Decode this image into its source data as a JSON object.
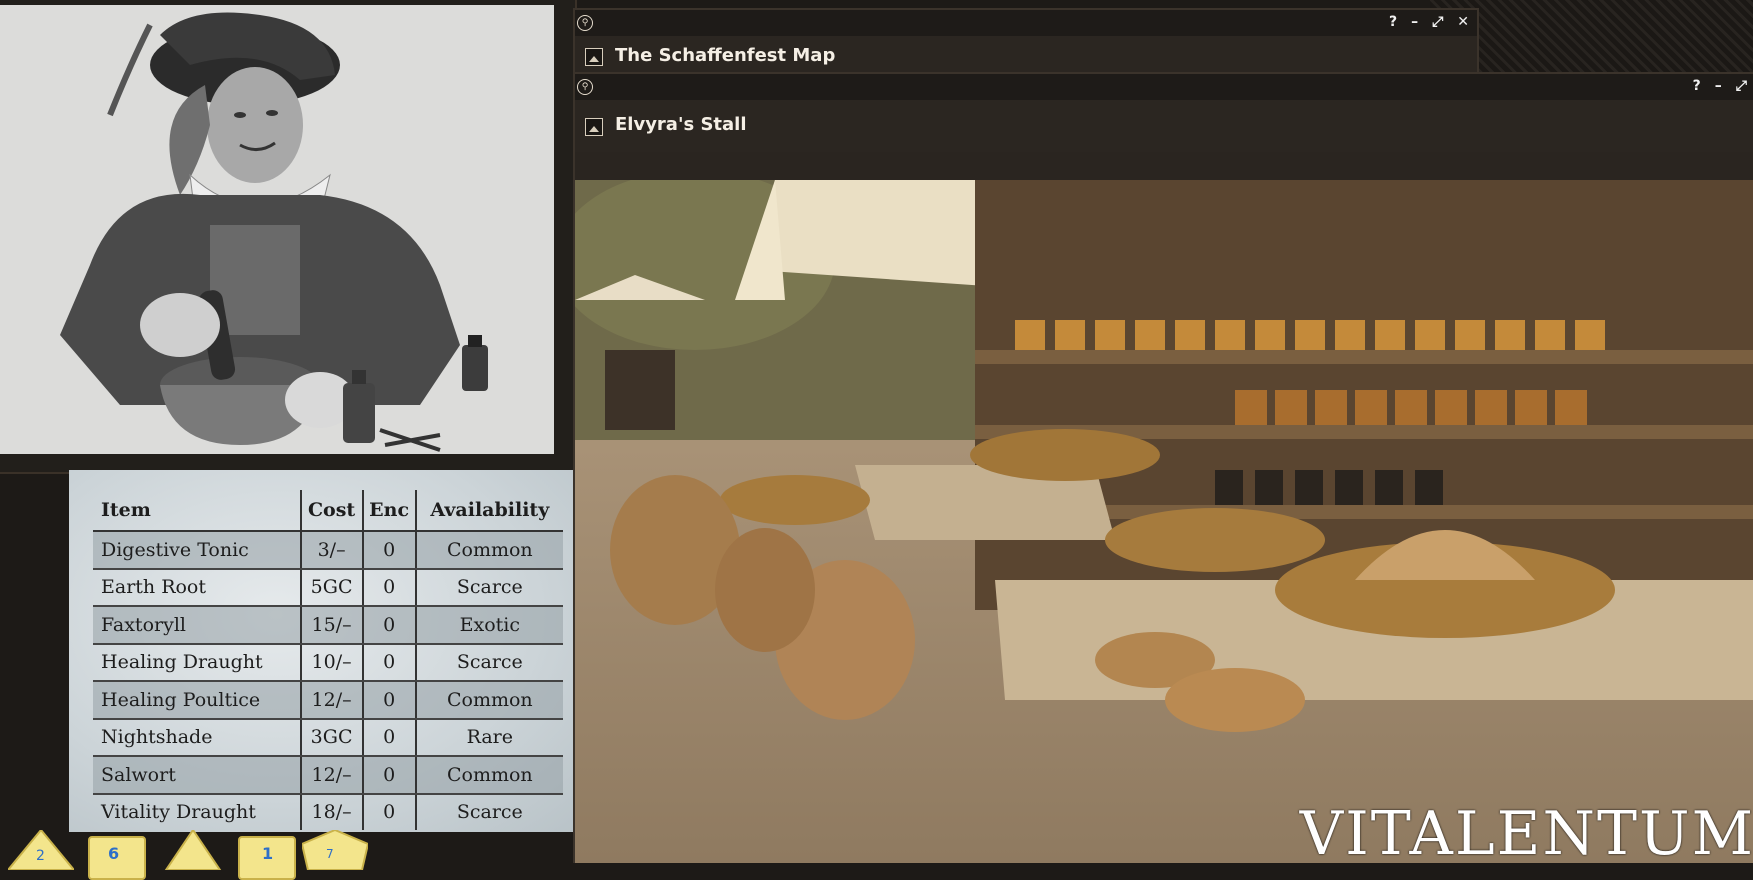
{
  "windows": [
    {
      "title": "The Schaffenfest Map",
      "controls": [
        "?",
        "–",
        "⤢",
        "✕"
      ]
    },
    {
      "title": "Elvyra's Stall",
      "controls": [
        "?",
        "–",
        "⤢"
      ]
    }
  ],
  "table": {
    "headers": [
      "Item",
      "Cost",
      "Enc",
      "Availability"
    ],
    "rows": [
      {
        "item": "Digestive Tonic",
        "cost": "3/–",
        "enc": "0",
        "availability": "Common"
      },
      {
        "item": "Earth Root",
        "cost": "5GC",
        "enc": "0",
        "availability": "Scarce"
      },
      {
        "item": "Faxtoryll",
        "cost": "15/–",
        "enc": "0",
        "availability": "Exotic"
      },
      {
        "item": "Healing Draught",
        "cost": "10/–",
        "enc": "0",
        "availability": "Scarce"
      },
      {
        "item": "Healing Poultice",
        "cost": "12/–",
        "enc": "0",
        "availability": "Common"
      },
      {
        "item": "Nightshade",
        "cost": "3GC",
        "enc": "0",
        "availability": "Rare"
      },
      {
        "item": "Salwort",
        "cost": "12/–",
        "enc": "0",
        "availability": "Common"
      },
      {
        "item": "Vitality Draught",
        "cost": "18/–",
        "enc": "0",
        "availability": "Scarce"
      }
    ]
  },
  "watermark": "VITALENTUM",
  "colors": {
    "dice": "#f3e58c",
    "dice_glyph": "#2d6fc8",
    "table_shade": "#96a0a6"
  }
}
